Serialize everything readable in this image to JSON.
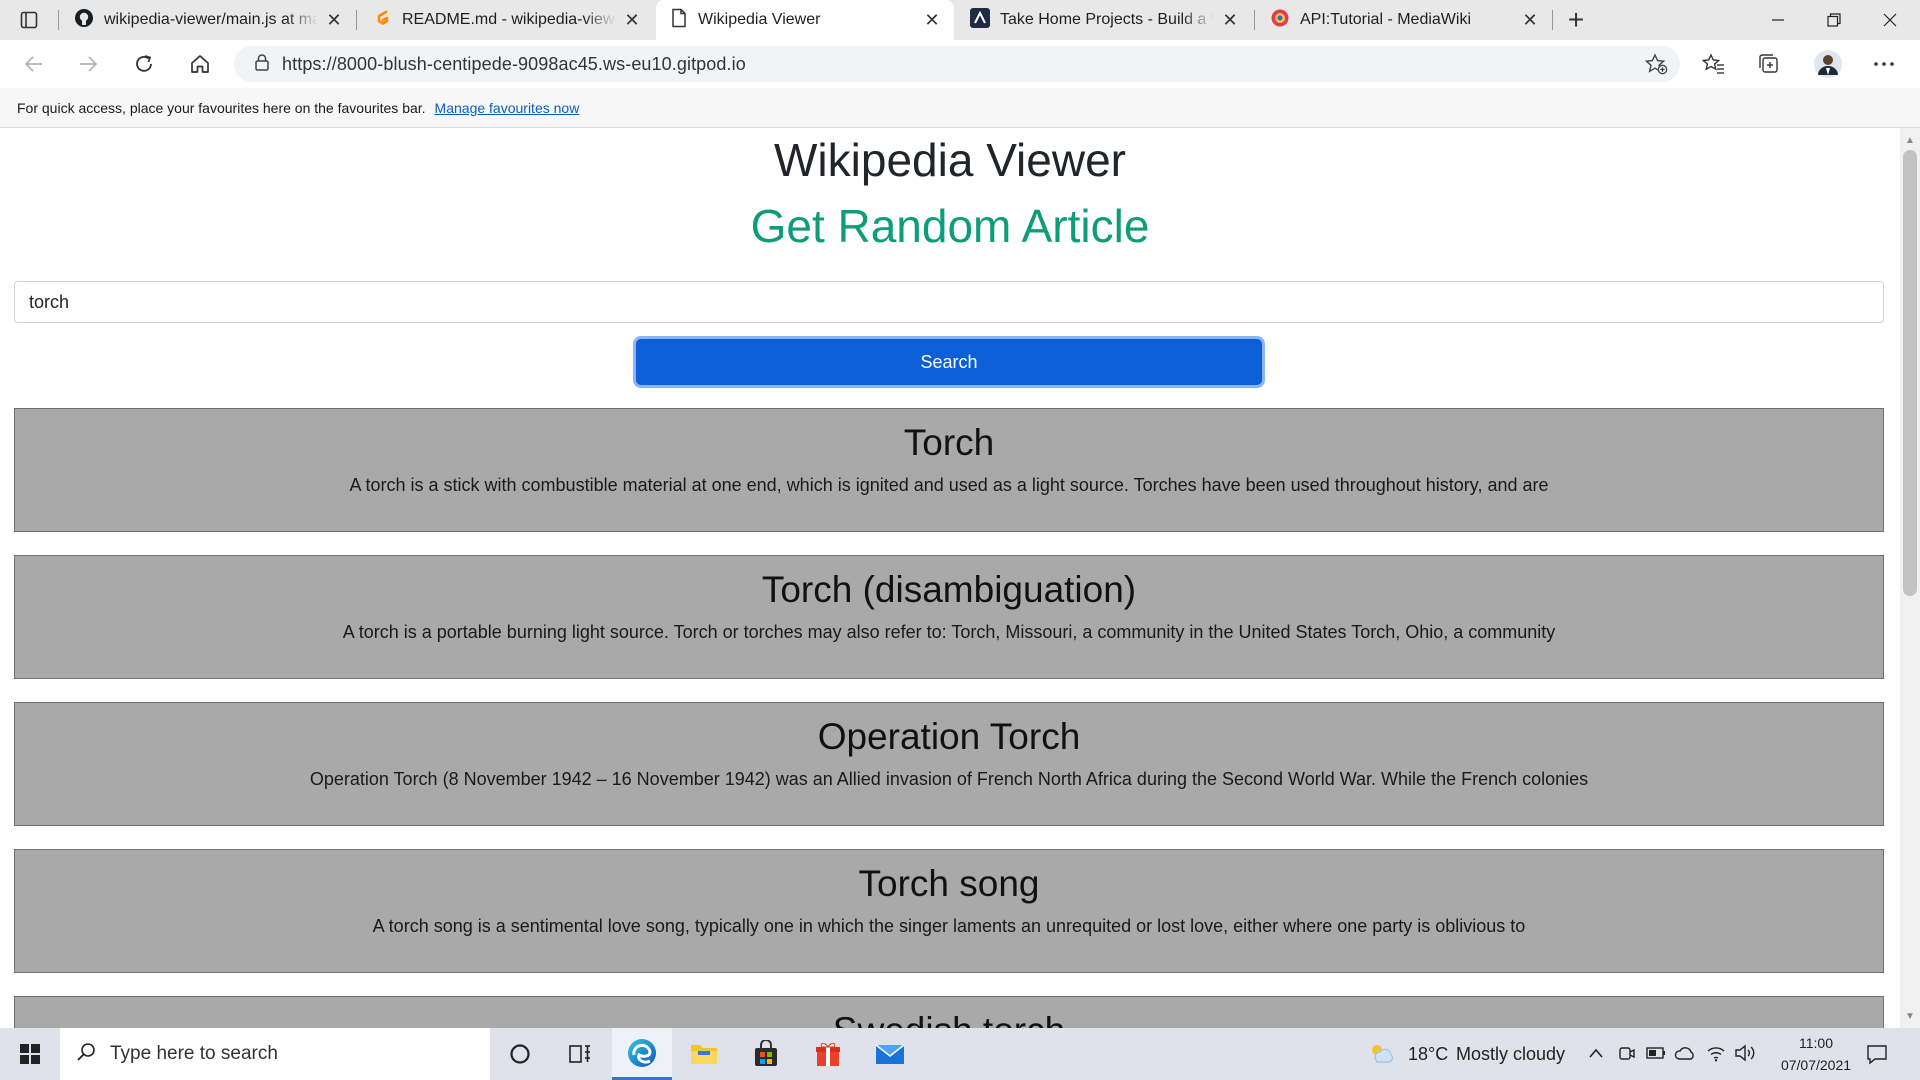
{
  "browser": {
    "tabs": [
      {
        "title": "wikipedia-viewer/main.js at mast",
        "icon": "github-icon",
        "active": false
      },
      {
        "title": "README.md - wikipedia-viewer",
        "icon": "gitpod-icon",
        "active": false
      },
      {
        "title": "Wikipedia Viewer",
        "icon": "page-icon",
        "active": true
      },
      {
        "title": "Take Home Projects - Build a Wik",
        "icon": "takehome-icon",
        "active": false
      },
      {
        "title": "API:Tutorial - MediaWiki",
        "icon": "mediawiki-icon",
        "active": false
      }
    ],
    "url": "https://8000-blush-centipede-9098ac45.ws-eu10.gitpod.io",
    "favourites_bar": {
      "message": "For quick access, place your favourites here on the favourites bar.",
      "link": "Manage favourites now"
    }
  },
  "page": {
    "title": "Wikipedia Viewer",
    "random_link": "Get Random Article",
    "search": {
      "value": "torch",
      "button": "Search"
    },
    "results": [
      {
        "title": "Torch",
        "snippet": "A torch is a stick with combustible material at one end, which is ignited and used as a light source. Torches have been used throughout history, and are"
      },
      {
        "title": "Torch (disambiguation)",
        "snippet": "A torch is a portable burning light source. Torch or torches may also refer to: Torch, Missouri, a community in the United States Torch, Ohio, a community"
      },
      {
        "title": "Operation Torch",
        "snippet": "Operation Torch (8 November 1942 – 16 November 1942) was an Allied invasion of French North Africa during the Second World War. While the French colonies"
      },
      {
        "title": "Torch song",
        "snippet": "A torch song is a sentimental love song, typically one in which the singer laments an unrequited or lost love, either where one party is oblivious to"
      },
      {
        "title": "Swedish torch",
        "snippet": ""
      }
    ]
  },
  "taskbar": {
    "search_placeholder": "Type here to search",
    "weather": {
      "temp": "18°C",
      "condition": "Mostly cloudy"
    },
    "time": "11:00",
    "date": "07/07/2021"
  },
  "colors": {
    "accent_green": "#0f9d79",
    "search_button": "#0d5fd8",
    "result_bg": "#a9a9a9"
  }
}
